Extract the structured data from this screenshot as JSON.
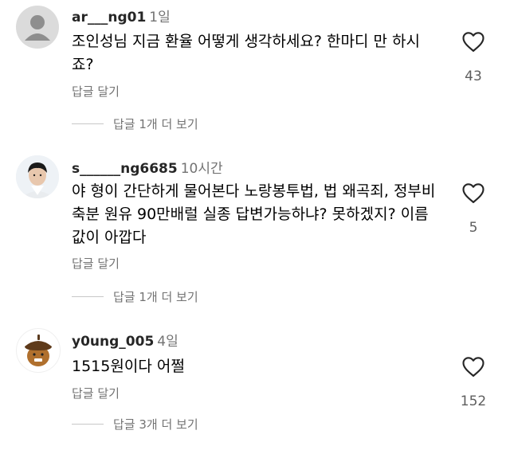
{
  "comments": [
    {
      "username": "ar___ng01",
      "time": "1일",
      "text": "조인성님 지금 환율 어떻게 생각하세요? 한마디 만 하시죠?",
      "reply_label": "답글 달기",
      "view_replies": "답글 1개 더 보기",
      "likes": "43",
      "avatar": "default-profile-icon"
    },
    {
      "username": "s______ng6685",
      "time": "10시간",
      "text": "야 형이 간단하게 물어본다 노랑봉투법, 법 왜곡죄, 정부비축분 원유 90만배럴 실종 답변가능하냐? 못하겠지? 이름값이 아깝다",
      "reply_label": "답글 달기",
      "view_replies": "답글 1개 더 보기",
      "likes": "5",
      "avatar": "photo-avatar"
    },
    {
      "username": "y0ung_005",
      "time": "4일",
      "text": "1515원이다 어쩔",
      "reply_label": "답글 달기",
      "view_replies": "답글 3개 더 보기",
      "likes": "152",
      "avatar": "acorn-avatar"
    }
  ],
  "colors": {
    "secondary": "#737373",
    "text": "#000000",
    "count": "#5e5e5e"
  }
}
